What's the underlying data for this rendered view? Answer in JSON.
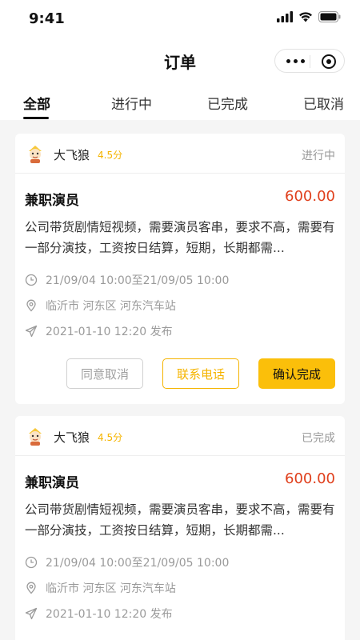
{
  "status_bar": {
    "time": "9:41"
  },
  "nav": {
    "title": "订单"
  },
  "tabs": [
    {
      "label": "全部",
      "active": true
    },
    {
      "label": "进行中",
      "active": false
    },
    {
      "label": "已完成",
      "active": false
    },
    {
      "label": "已取消",
      "active": false
    }
  ],
  "orders": [
    {
      "user": "大飞狼",
      "rating": "4.5分",
      "status": "进行中",
      "title": "兼职演员",
      "price": "600.00",
      "description": "公司带货剧情短视频，需要演员客串，要求不高，需要有一部分演技，工资按日结算，短期，长期都需...",
      "time_range": "21/09/04 10:00至21/09/05 10:00",
      "location": "临沂市 河东区 河东汽车站",
      "published": "2021-01-10 12:20 发布",
      "buttons": {
        "cancel": "同意取消",
        "phone": "联系电话",
        "confirm": "确认完成"
      }
    },
    {
      "user": "大飞狼",
      "rating": "4.5分",
      "status": "已完成",
      "title": "兼职演员",
      "price": "600.00",
      "description": "公司带货剧情短视频，需要演员客串，要求不高，需要有一部分演技，工资按日结算，短期，长期都需...",
      "time_range": "21/09/04 10:00至21/09/05 10:00",
      "location": "临沂市 河东区 河东汽车站",
      "published": "2021-01-10 12:20 发布"
    }
  ],
  "icons": {
    "signal": "cellular-signal-icon",
    "wifi": "wifi-icon",
    "battery": "battery-icon",
    "more": "more-dots-icon",
    "close": "target-circle-icon",
    "avatar": "cartoon-avatar-icon",
    "clock": "clock-icon",
    "location": "location-pin-icon",
    "send": "paper-plane-icon"
  },
  "colors": {
    "accent": "#fbbf0a",
    "rating": "#f5b400",
    "price": "#e0401d",
    "muted": "#9a9a9a",
    "background": "#f5f5f5"
  }
}
